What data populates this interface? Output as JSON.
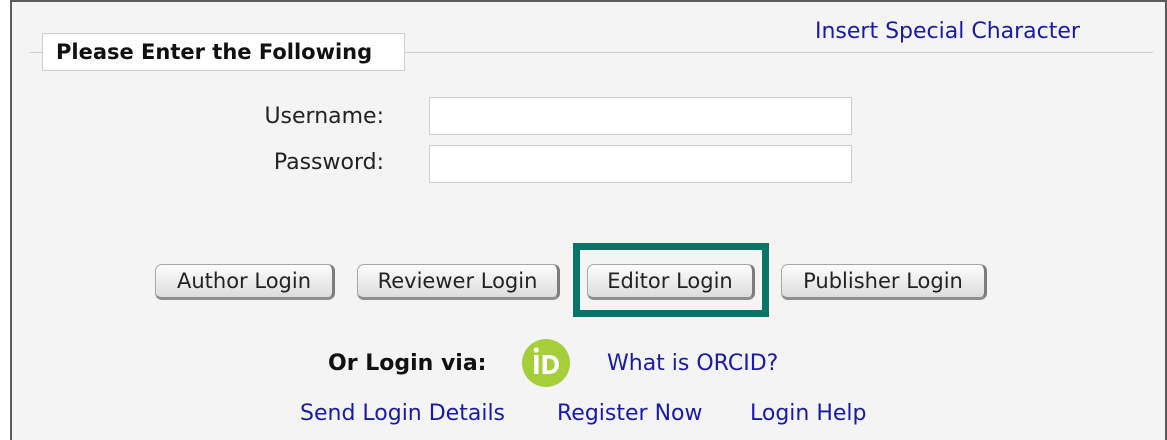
{
  "header": {
    "special_char_link": "Insert Special Character",
    "legend": "Please Enter the Following"
  },
  "form": {
    "username_label": "Username:",
    "username_value": "",
    "password_label": "Password:",
    "password_value": ""
  },
  "buttons": {
    "author": "Author Login",
    "reviewer": "Reviewer Login",
    "editor": "Editor Login",
    "publisher": "Publisher Login"
  },
  "orcid": {
    "label": "Or Login via:",
    "icon": "orcid-icon",
    "icon_color": "#a6ce39",
    "what_is_link": "What is ORCID?"
  },
  "links": {
    "send_details": "Send Login Details",
    "register": "Register Now",
    "help": "Login Help"
  },
  "colors": {
    "link": "#1a1aa8",
    "highlight": "#087566"
  }
}
